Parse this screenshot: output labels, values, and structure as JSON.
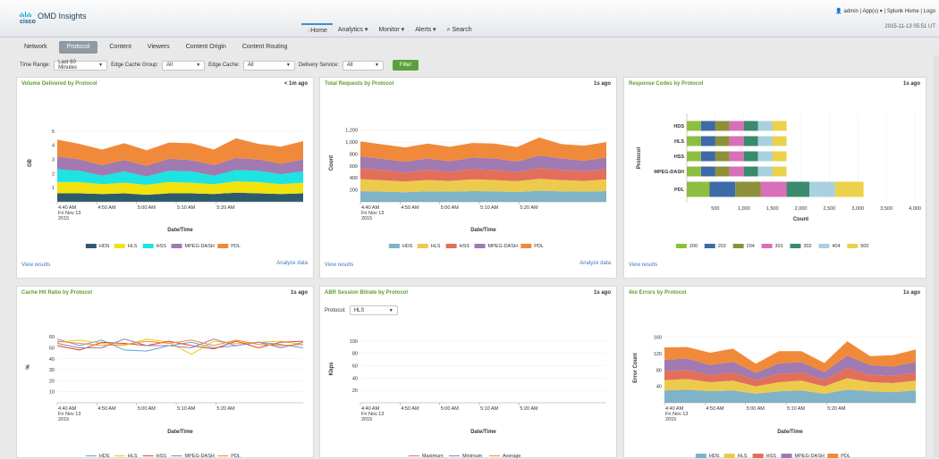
{
  "header": {
    "brand": "cisco",
    "app_title": "OMD Insights",
    "nav": [
      {
        "label": "Home",
        "active": true
      },
      {
        "label": "Analytics ▾"
      },
      {
        "label": "Monitor ▾"
      },
      {
        "label": "Alerts ▾"
      },
      {
        "label": "Search"
      }
    ],
    "user": "admin",
    "apps": "App(s) ▾",
    "splunk_home": "Splunk Home",
    "logout": "Logo",
    "datetime": "2015-11-13 05:51 UT"
  },
  "tabs": [
    {
      "label": "Network"
    },
    {
      "label": "Protocol",
      "active": true
    },
    {
      "label": "Content"
    },
    {
      "label": "Viewers"
    },
    {
      "label": "Content Origin"
    },
    {
      "label": "Content Routing"
    }
  ],
  "filters": {
    "time_range_label": "Time Range:",
    "time_range_value": "Last 60 Minutes",
    "edge_cache_group_label": "Edge Cache Group:",
    "edge_cache_group_value": "All",
    "edge_cache_label": "Edge Cache:",
    "edge_cache_value": "All",
    "delivery_service_label": "Delivery Service:",
    "delivery_service_value": "All",
    "filter_button": "Filter"
  },
  "colors": {
    "HDS": "#2e5b6b",
    "HLS": "#f2e30e",
    "HSS": "#1ee3e3",
    "MPEG-DASH": "#a07ab0",
    "PDL": "#f08a3a",
    "title_green": "#5c9e2e"
  },
  "common": {
    "view_results": "View results",
    "analyze_data": "Analyze data",
    "x_ticks": [
      "4:40 AM\nFri Nov 13\n2015",
      "4:50 AM",
      "5:00 AM",
      "5:10 AM",
      "5:20 AM"
    ],
    "xlabel": "Date/Time"
  },
  "panels": {
    "volume": {
      "title": "Volume Delivered by Protocol",
      "ago": "< 1m ago"
    },
    "requests": {
      "title": "Total Requests by Protocol",
      "ago": "1s ago"
    },
    "codes": {
      "title": "Response Codes by Protocol",
      "ago": "1s ago"
    },
    "cachehit": {
      "title": "Cache Hit Ratio by Protocol",
      "ago": "1s ago"
    },
    "abr": {
      "title": "ABR Session Bitrate by Protocol",
      "ago": "1s ago",
      "protocol_label": "Protocol:",
      "protocol_value": "HLS"
    },
    "errors": {
      "title": "4xx Errors by Protocol",
      "ago": "1s ago"
    }
  },
  "chart_data": [
    {
      "id": "volume",
      "type": "area",
      "ylabel": "GB",
      "xlabel": "Date/Time",
      "ylim": [
        0,
        5.5
      ],
      "yticks": [
        1,
        2,
        3,
        4,
        5
      ],
      "stacked": true,
      "series": [
        {
          "name": "HDS",
          "color": "#2e5b6b",
          "values": [
            0.6,
            0.6,
            0.55,
            0.6,
            0.5,
            0.6,
            0.6,
            0.55,
            0.65,
            0.6,
            0.55,
            0.6
          ]
        },
        {
          "name": "HLS",
          "color": "#f2e30e",
          "values": [
            0.8,
            0.8,
            0.7,
            0.75,
            0.7,
            0.8,
            0.75,
            0.7,
            0.8,
            0.8,
            0.7,
            0.75
          ]
        },
        {
          "name": "HSS",
          "color": "#1ee3e3",
          "values": [
            0.9,
            0.8,
            0.6,
            0.8,
            0.6,
            0.8,
            0.8,
            0.6,
            0.8,
            0.8,
            0.7,
            0.8
          ]
        },
        {
          "name": "MPEG-DASH",
          "color": "#a07ab0",
          "values": [
            0.9,
            0.8,
            0.75,
            0.8,
            0.75,
            0.85,
            0.8,
            0.75,
            0.85,
            0.8,
            0.75,
            0.85
          ]
        },
        {
          "name": "PDL",
          "color": "#f08a3a",
          "values": [
            1.2,
            1.1,
            1.1,
            1.2,
            1.1,
            1.15,
            1.2,
            1.1,
            1.4,
            1.1,
            1.2,
            1.3
          ]
        }
      ]
    },
    {
      "id": "requests",
      "type": "area",
      "ylabel": "Count",
      "xlabel": "Date/Time",
      "ylim": [
        0,
        1300
      ],
      "yticks": [
        200,
        400,
        600,
        800,
        "1,000",
        "1,200"
      ],
      "stacked": true,
      "series": [
        {
          "name": "HDS",
          "color": "#7fb3c8",
          "values": [
            180,
            170,
            160,
            175,
            170,
            180,
            175,
            165,
            185,
            175,
            170,
            180
          ]
        },
        {
          "name": "HLS",
          "color": "#eccb4c",
          "values": [
            200,
            190,
            180,
            190,
            180,
            195,
            190,
            180,
            200,
            190,
            180,
            195
          ]
        },
        {
          "name": "HSS",
          "color": "#e36f5a",
          "values": [
            180,
            170,
            150,
            170,
            150,
            170,
            170,
            150,
            180,
            170,
            160,
            170
          ]
        },
        {
          "name": "MPEG-DASH",
          "color": "#a07ab0",
          "values": [
            200,
            190,
            180,
            190,
            180,
            195,
            190,
            180,
            210,
            190,
            180,
            195
          ]
        },
        {
          "name": "PDL",
          "color": "#f08a3a",
          "values": [
            250,
            240,
            240,
            250,
            240,
            245,
            250,
            240,
            300,
            240,
            250,
            260
          ]
        }
      ]
    },
    {
      "id": "codes",
      "type": "bar",
      "orientation": "horizontal",
      "stacked": true,
      "ylabel": "Protocol",
      "xlabel": "Count",
      "xlim": [
        0,
        4000
      ],
      "xticks": [
        500,
        "1,000",
        "1,500",
        "2,000",
        "2,500",
        "3,000",
        "3,500",
        "4,000"
      ],
      "categories": [
        "HDS",
        "HLS",
        "HSS",
        "MPEG-DASH",
        "PDL"
      ],
      "series": [
        {
          "name": "200",
          "color": "#8cbf3f",
          "values": [
            250,
            250,
            250,
            250,
            400
          ]
        },
        {
          "name": "202",
          "color": "#3d6aa8",
          "values": [
            250,
            250,
            250,
            250,
            450
          ]
        },
        {
          "name": "204",
          "color": "#8e8f3a",
          "values": [
            250,
            250,
            250,
            250,
            450
          ]
        },
        {
          "name": "301",
          "color": "#d86fb8",
          "values": [
            250,
            250,
            250,
            250,
            450
          ]
        },
        {
          "name": "302",
          "color": "#3a8a6e",
          "values": [
            250,
            250,
            250,
            250,
            400
          ]
        },
        {
          "name": "404",
          "color": "#a8d0e0",
          "values": [
            250,
            250,
            250,
            250,
            450
          ]
        },
        {
          "name": "500",
          "color": "#ecd14a",
          "values": [
            250,
            250,
            250,
            250,
            500
          ]
        }
      ]
    },
    {
      "id": "cachehit",
      "type": "line",
      "ylabel": "%",
      "xlabel": "Date/Time",
      "ylim": [
        0,
        65
      ],
      "yticks": [
        10,
        20,
        30,
        40,
        50,
        60
      ],
      "series": [
        {
          "name": "HDS",
          "color": "#5aa7d6",
          "values": [
            58,
            52,
            57,
            48,
            47,
            52,
            55,
            50,
            52,
            55,
            53,
            50
          ]
        },
        {
          "name": "HLS",
          "color": "#f2c40e",
          "values": [
            55,
            57,
            54,
            52,
            58,
            55,
            44,
            56,
            54,
            55,
            56,
            53
          ]
        },
        {
          "name": "HSS",
          "color": "#d64a2e",
          "values": [
            52,
            48,
            55,
            54,
            52,
            56,
            52,
            49,
            56,
            50,
            55,
            56
          ]
        },
        {
          "name": "MPEG-DASH",
          "color": "#a07ab0",
          "values": [
            54,
            50,
            50,
            58,
            52,
            52,
            50,
            58,
            52,
            55,
            50,
            55
          ]
        },
        {
          "name": "PDL",
          "color": "#f08a3a",
          "values": [
            56,
            54,
            52,
            53,
            56,
            54,
            57,
            52,
            57,
            53,
            52,
            53
          ]
        }
      ]
    },
    {
      "id": "abr",
      "type": "line",
      "ylabel": "Kbps",
      "xlabel": "Date/Time",
      "ylim": [
        0,
        110
      ],
      "yticks": [
        20,
        40,
        60,
        80,
        100
      ],
      "series": [
        {
          "name": "Maximum",
          "color": "#e36f5a",
          "values": []
        },
        {
          "name": "Minimum",
          "color": "#a07ab0",
          "values": []
        },
        {
          "name": "Average",
          "color": "#f08a3a",
          "values": []
        }
      ]
    },
    {
      "id": "errors",
      "type": "area",
      "ylabel": "Error Count",
      "xlabel": "Date/Time",
      "ylim": [
        0,
        170
      ],
      "yticks": [
        40,
        80,
        120,
        160
      ],
      "stacked": true,
      "series": [
        {
          "name": "HDS",
          "color": "#7fb3c8",
          "values": [
            30,
            32,
            28,
            30,
            22,
            28,
            30,
            22,
            32,
            28,
            26,
            30
          ]
        },
        {
          "name": "HLS",
          "color": "#eccb4c",
          "values": [
            25,
            26,
            22,
            24,
            18,
            22,
            24,
            18,
            28,
            22,
            22,
            24
          ]
        },
        {
          "name": "HSS",
          "color": "#e36f5a",
          "values": [
            22,
            22,
            18,
            20,
            15,
            20,
            20,
            15,
            25,
            18,
            18,
            20
          ]
        },
        {
          "name": "MPEG-DASH",
          "color": "#a07ab0",
          "values": [
            28,
            28,
            24,
            26,
            18,
            26,
            25,
            20,
            30,
            24,
            22,
            26
          ]
        },
        {
          "name": "PDL",
          "color": "#f08a3a",
          "values": [
            30,
            28,
            30,
            32,
            22,
            30,
            27,
            22,
            35,
            22,
            28,
            30
          ]
        }
      ]
    }
  ]
}
